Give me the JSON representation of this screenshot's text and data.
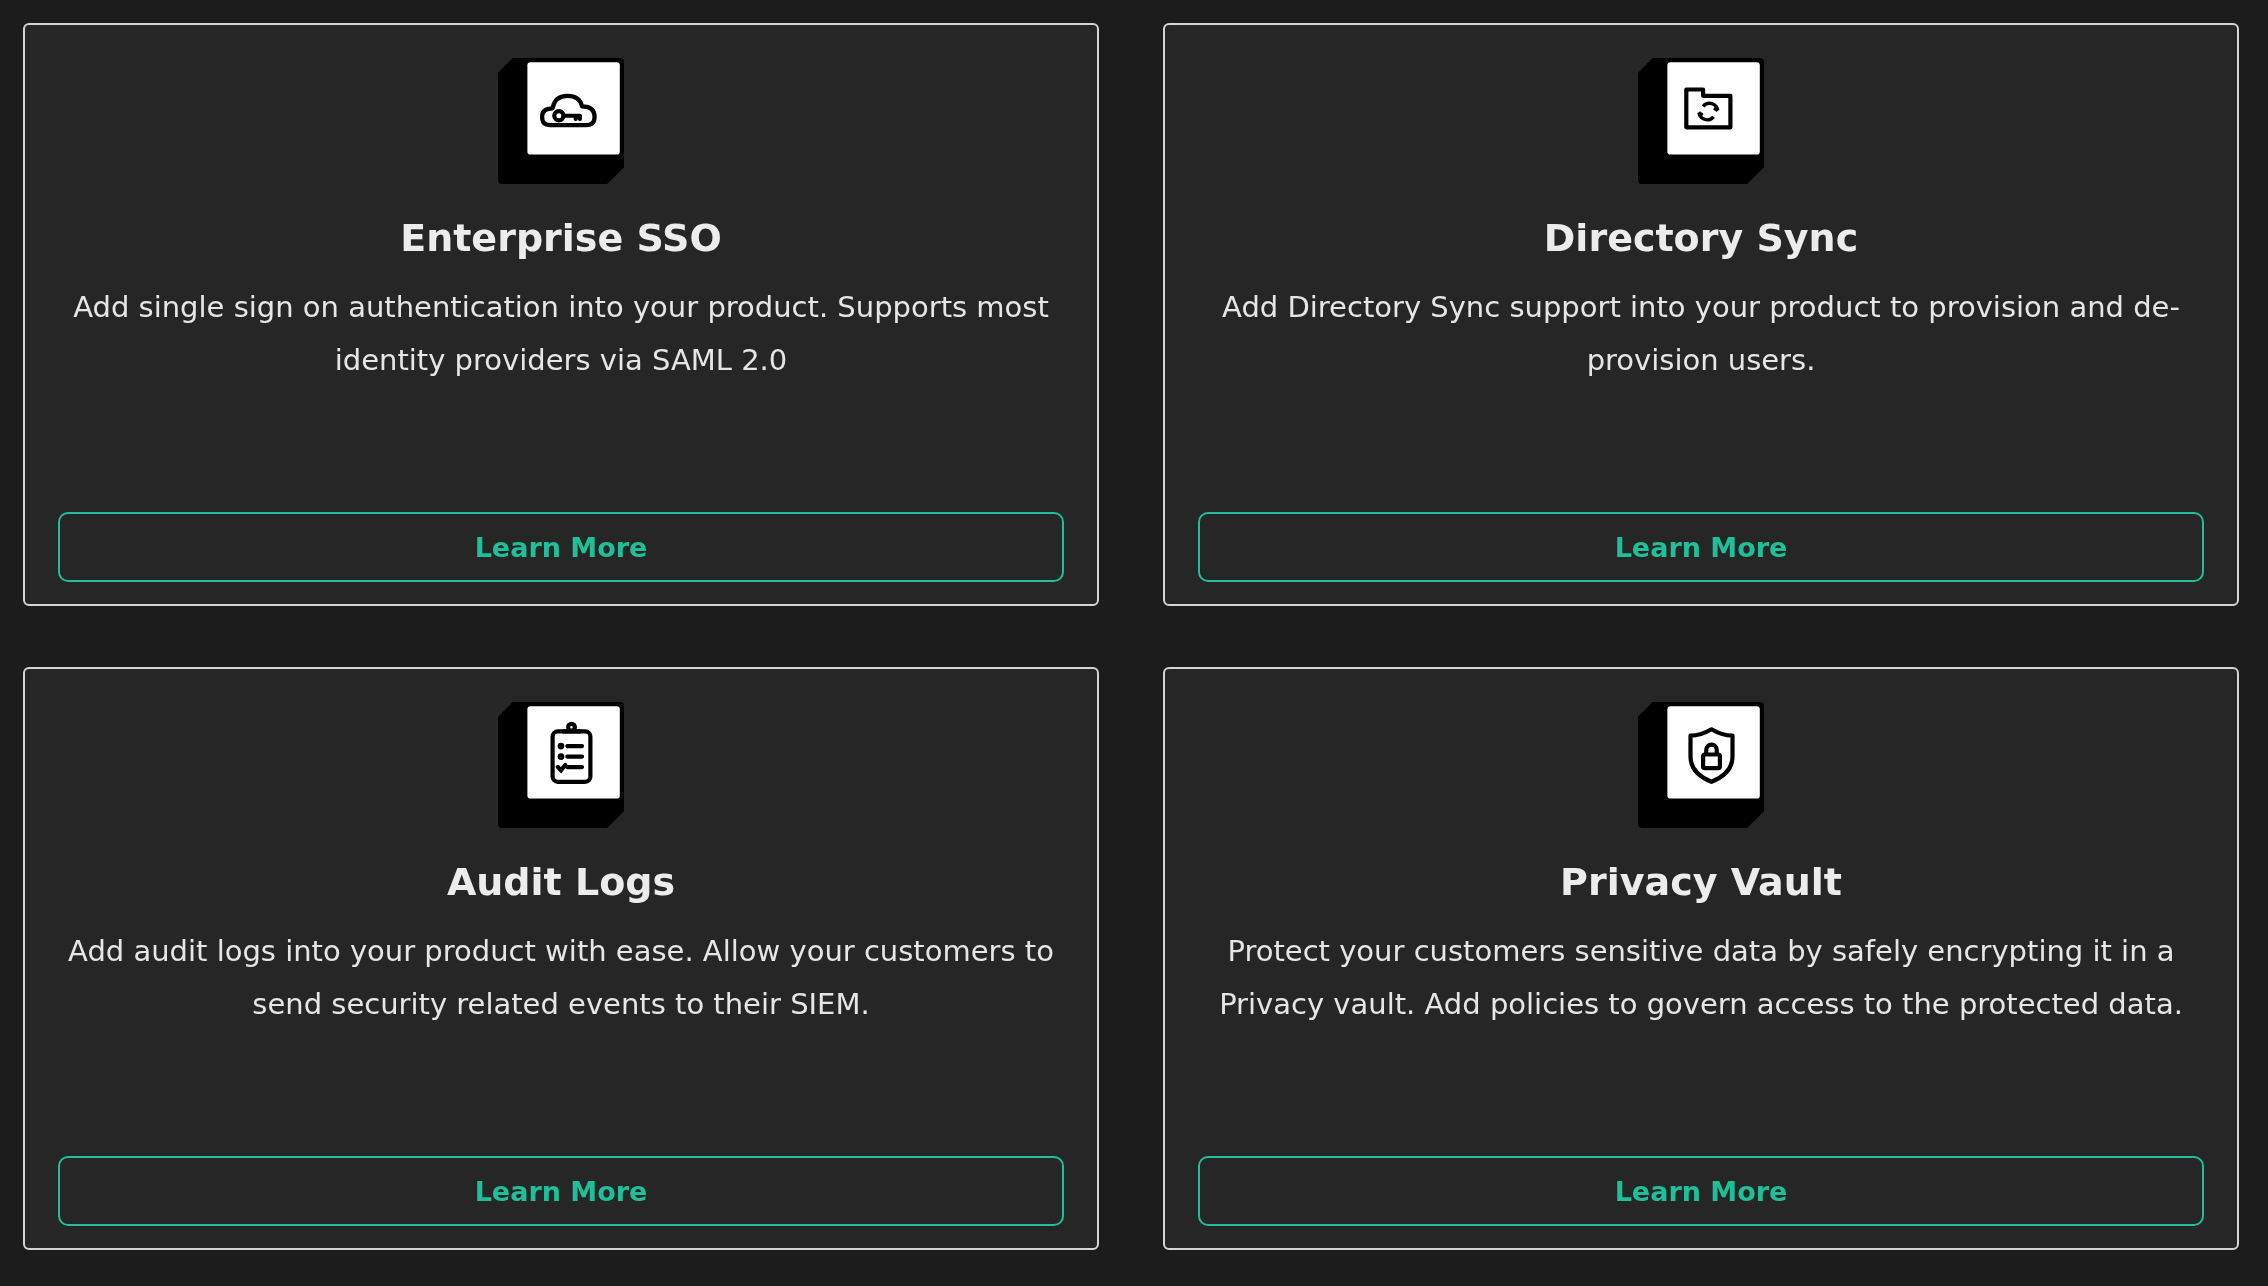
{
  "cards": [
    {
      "kind": "cloud-key",
      "title": "Enterprise SSO",
      "description": "Add single sign on authentication into your product. Supports most identity providers via SAML 2.0",
      "button": "Learn More"
    },
    {
      "kind": "folder-sync",
      "title": "Directory Sync",
      "description": "Add Directory Sync support into your product to provision and de-provision users.",
      "button": "Learn More"
    },
    {
      "kind": "clipboard",
      "title": "Audit Logs",
      "description": "Add audit logs into your product with ease. Allow your customers to send security related events to their SIEM.",
      "button": "Learn More"
    },
    {
      "kind": "shield-lock",
      "title": "Privacy Vault",
      "description": "Protect your customers sensitive data by safely encrypting it in a Privacy vault. Add policies to govern access to the protected data.",
      "button": "Learn More"
    }
  ]
}
